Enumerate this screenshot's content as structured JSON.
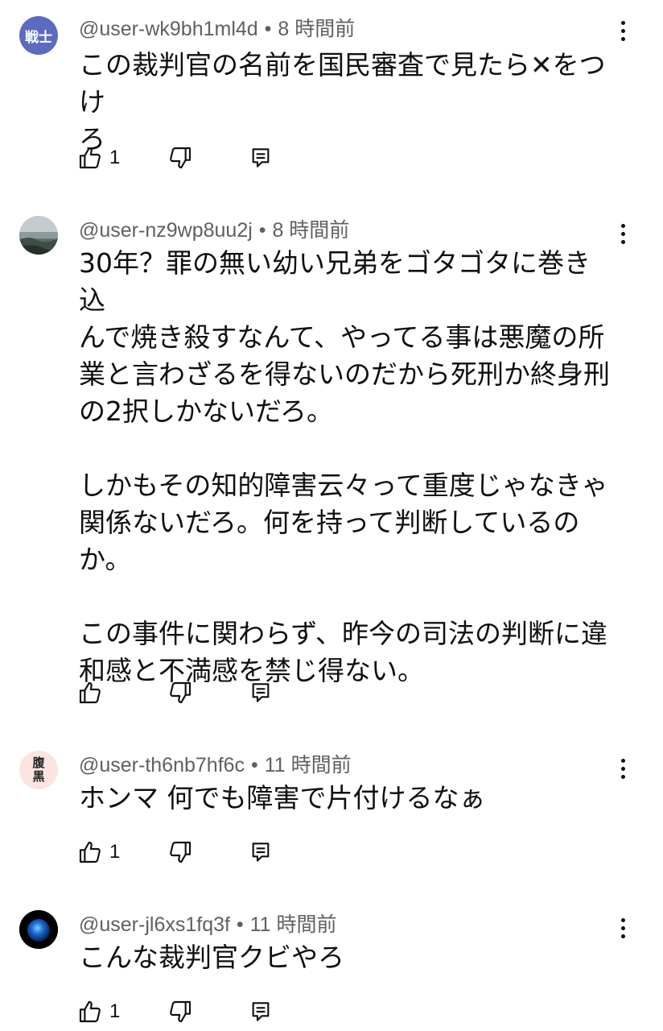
{
  "comments": [
    {
      "avatar_text": "戦士",
      "handle": "@user-wk9bh1ml4d",
      "separator": "•",
      "time": "8 時間前",
      "text": "この裁判官の名前を国民審査で見たら✕をつけ\nろ",
      "likes": "1",
      "avatar_color": "#5c6bc0"
    },
    {
      "avatar_text": "",
      "handle": "@user-nz9wp8uu2j",
      "separator": "•",
      "time": "8 時間前",
      "text": "30年？罪の無い幼い兄弟をゴタゴタに巻き込\nんで焼き殺すなんて、やってる事は悪魔の所\n業と言わざるを得ないのだから死刑か終身刑\nの2択しかないだろ。\n\nしかもその知的障害云々って重度じゃなきゃ\n関係ないだろ。何を持って判断しているの\nか。\n\nこの事件に関わらず、昨今の司法の判断に違\n和感と不満感を禁じ得ない。",
      "likes": ""
    },
    {
      "avatar_text": "腹\n黒",
      "handle": "@user-th6nb7hf6c",
      "separator": "•",
      "time": "11 時間前",
      "text": "ホンマ 何でも障害で片付けるなぁ",
      "likes": "1",
      "avatar_color": "#fbe4e0"
    },
    {
      "avatar_text": "",
      "handle": "@user-jl6xs1fq3f",
      "separator": "•",
      "time": "11 時間前",
      "text": "こんな裁判官クビやろ",
      "likes": "1"
    }
  ],
  "icons": {
    "like": "thumb-up-icon",
    "dislike": "thumb-down-icon",
    "reply": "reply-icon",
    "menu": "more-vert-icon"
  }
}
